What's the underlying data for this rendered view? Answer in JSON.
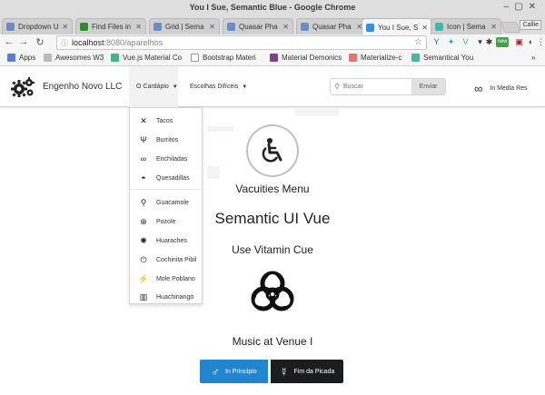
{
  "window": {
    "title": "You I Sue, Semantic Blue - Google Chrome"
  },
  "tabs": [
    {
      "label": "Dropdown U",
      "color": "#6a8cc8",
      "active": false
    },
    {
      "label": "Find Files in",
      "color": "#2e8b2e",
      "active": false
    },
    {
      "label": "Grid | Sema",
      "color": "#6a8cc8",
      "active": false
    },
    {
      "label": "Quasar Pha",
      "color": "#6a8cc8",
      "active": false
    },
    {
      "label": "Quasar Pha",
      "color": "#6a8cc8",
      "active": false
    },
    {
      "label": "You I Sue, S",
      "color": "#2196f3",
      "active": true
    },
    {
      "label": "Icon | Sema",
      "color": "#35bdb2",
      "active": false
    }
  ],
  "user_chip": "Callie",
  "address": {
    "host": "localhost",
    "path": ":8080/aparelhos"
  },
  "bookmarks": [
    {
      "label": "Apps",
      "color": "#5a7bd6"
    },
    {
      "label": "Awesomes W3",
      "color": "#bbbbbb"
    },
    {
      "label": "Vue.js Material Co",
      "color": "#41b883"
    },
    {
      "label": "Bootstrap Materi",
      "color": "#ffffff"
    },
    {
      "label": "Material Demonics",
      "color": "#7e3d9f"
    },
    {
      "label": "Materialize-c",
      "color": "#ee6e73"
    },
    {
      "label": "Semantical You",
      "color": "#35bdb2"
    }
  ],
  "bookmarks_more": "»",
  "navbar": {
    "brand": "Engenho Novo LLC",
    "menu": [
      {
        "label": "O Cardápio",
        "active": true
      },
      {
        "label": "Escolhas Difíceis",
        "active": false
      }
    ],
    "search_placeholder": "Buscar",
    "search_button": "Enviar",
    "right_item": "In Media Res"
  },
  "dropdown": {
    "group1": [
      {
        "label": "Tacos",
        "icon": "utensils-icon"
      },
      {
        "label": "Burritos",
        "icon": "fork-knife-icon"
      },
      {
        "label": "Enchiladas",
        "icon": "infinity-icon"
      },
      {
        "label": "Quesadillas",
        "icon": "dish-icon"
      }
    ],
    "group2": [
      {
        "label": "Guacamole",
        "icon": "bicycle-icon"
      },
      {
        "label": "Pozole",
        "icon": "crosshairs-icon"
      },
      {
        "label": "Huaraches",
        "icon": "spinner-icon"
      },
      {
        "label": "Cochinita Pibil",
        "icon": "power-icon"
      },
      {
        "label": "Mole Poblano",
        "icon": "lightning-icon"
      },
      {
        "label": "Huachinango",
        "icon": "building-icon"
      }
    ]
  },
  "content": {
    "header1": "Vacuities Menu",
    "header2": "Semantic UI Vue",
    "header3": "Use Vitamin Cue",
    "header4": "Music at Venue I",
    "button_primary": "In Principio",
    "button_secondary": "Fim da Picada"
  },
  "colors": {
    "primary_button": "#2185d0",
    "secondary_button": "#1b1c1d"
  }
}
